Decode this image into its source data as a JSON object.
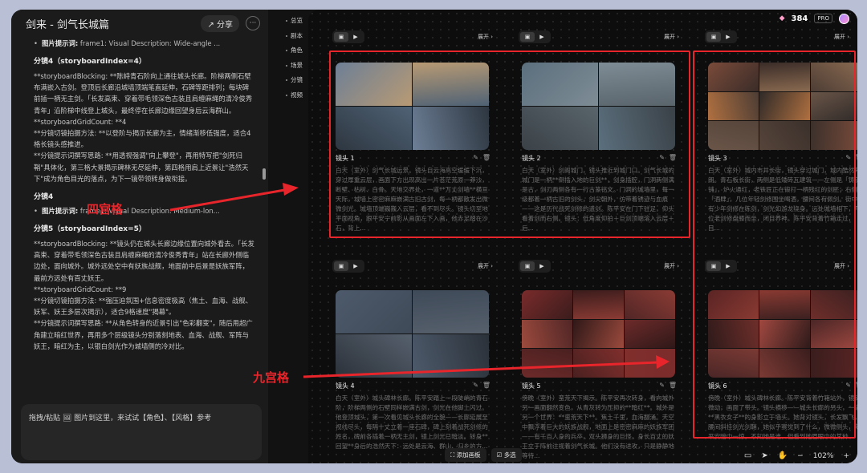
{
  "window": {
    "title": "剑来 - 剑气长城篇",
    "share_label": "分享",
    "more_label": "···"
  },
  "chat": {
    "blocks": [
      {
        "type": "bullet",
        "key": "图片提示词:",
        "text": "frame1: Visual Description: Wide-angle ..."
      },
      {
        "type": "heading",
        "text": "分镜4（storyboardIndex=4）"
      },
      {
        "type": "para",
        "text": "**storyboardBlocking: **陈峙青石阶向上通往城头长廊。阶梯两侧石壁布满嵌入古剑。登顶后长廊沿城墙顶端笔直延伸，石碑等距排列；每块碑前插一柄无主剑。「长发高束、穿着带毛领深色古装且肩缠麻绳的清冷俊秀青年」沿阶梯中线登上城头，最终停在长廊边缘回望身后云海群山。"
      },
      {
        "type": "para",
        "text": "**storyboardGridCount: **4"
      },
      {
        "type": "para",
        "text": "**分镜切镜拍摄方法: **以登阶与揭示长廊为主，情绪渐移低强度，适合4格长镜头感推进。"
      },
      {
        "type": "para",
        "text": "**分镜提示词撰写思路: **用透视强调\"向上攀登\"，再用特写把\"剑死归鞘\"具体化，第三格大景揭示碑林无尽延伸，第四格用肩上近景让\"浩然天下\"成为角色目光的落点，为下一镜带领转身做衔接。"
      },
      {
        "type": "heading",
        "text": "分镜4"
      },
      {
        "type": "bullet",
        "key": "图片提示词:",
        "text": "frame1: Visual Description: Medium-lon..."
      },
      {
        "type": "heading",
        "text": "分镜5（storyboardIndex=5）"
      },
      {
        "type": "para",
        "text": "**storyboardBlocking: **镜头仍在城头长廊边缘位置向城外看去。「长发高束、穿着带毛领深色古装且肩缠麻绳的清冷俊秀青年」站在长廊外侧临边处，面向城外。城外远处空中有妖族战舰，地面前中后景是妖族军阵，最前方远处有百丈妖王。"
      },
      {
        "type": "para",
        "text": "**storyboardGridCount: **9"
      },
      {
        "type": "para",
        "text": "**分镜切镜拍摄方法: **强压迫氛围+信息密度极高（焦土、血海、战舰、妖军、妖王多层次揭示），适合9格速度\"揭幕\"。"
      },
      {
        "type": "para",
        "text": "**分镜提示词撰写思路: **从角色转身的近景引出\"色彩翻变\"，随后用超广角建立暗红世界，再用多个层级镜头分别落刻地表、血海、战舰、军阵与妖王，暗红为主，以银白剑光作为城墙侧的冷对比。"
      }
    ],
    "input_placeholder": "拖拽/粘贴 🖼 图片到这里，来试试【角色】、【风格】参考"
  },
  "nav": [
    "总览",
    "剧本",
    "角色",
    "场景",
    "分镜",
    "视频"
  ],
  "topbar": {
    "credits": "384",
    "plan": "PRO"
  },
  "columns": {
    "expand_label": "展开 ›"
  },
  "cards": [
    {
      "label": "镜头 1",
      "grid": 4,
      "palette": [
        "#6d7f96",
        "#b89a74",
        "#4f6275",
        "#2d3640"
      ],
      "desc": "白天（室外）剑气长城远景。镜头自云海高空缓缓下沉，穿过厚重云层，画面下方出现高出一片苍茫荒原一莽沙，断壁、枯树、白骨。天地交界处，一道**万丈剑墙**横亘天际，城墙上密密麻麻嵌满古旧古剑，每一柄都散发出微微剑光。城墙顶端巍巍入云层，看不到尽头。镜头切至地平面视角，跟平安宁前影从画面左下入画，他赤足踏在沙石，背上..."
    },
    {
      "label": "镜头 2",
      "grid": 4,
      "palette": [
        "#5b6f7d",
        "#7e8c95",
        "#59646b",
        "#3a4147"
      ],
      "desc": "白天（室外）剑阁城门，镜头推近到城门口。剑气长城的城门是一柄**倒插入地的巨剑**，剑身插腔，门洞两侧满是古，剑刃两侧各有一行古篆铭文。门洞的城墙里，每一级都着一柄古旧的剑头，剑尖朝外，仿带着锈迹与血痕——这是历代战死剑修的遗剑。陈平安在门下驻足，仰头看着剑而右侧。镜头：低角度仰拍＋巨剑顶端溶入云层＋后..."
    },
    {
      "label": "镜头 3",
      "grid": 9,
      "palette": [
        "#7a4b3a",
        "#3a2c28",
        "#8a6a50",
        "#4d3d35",
        "#b07040",
        "#2f2a28",
        "#6a5548",
        "#55443a",
        "#3b302b"
      ],
      "desc": "白天（室外）城内市井长街，镜头穿过城门，城内酷然开朗。青石板长街，两侧是低矮砖瓦建筑——左侧是「铸剑铺」，炉火通红，老铁匠正在锻打一柄残红的剑胚；右侧是「酒肆」，几位年轻剑修围坐喝酒，腰间各有佩剑。街中央有少年剑修在练剑，剑光如游龙绕身。远处城墙相下，几位老剑修盘膝而坐，闭目养神。陈平安背着竹箱走过，目..."
    },
    {
      "label": "镜头 4",
      "grid": 4,
      "palette": [
        "#4d5a6b",
        "#3f4a58",
        "#56606d",
        "#2b3139"
      ],
      "desc": "白天（室外）城头碑林长廊。陈平安踏上一段陡峭的青石阶，阶梯两侧的石壁同样嵌满古剑，剑光在他脚上闪过。他登顶城头，第一次看见城头长廊的全貌——长廊延展至视线尽头，每隔十丈立着一座石碑，碑上刻着战死剑修的姓名，碑前各插着一柄无主剑，镜上剑光已暗淡。转身**回望**身后的浩然天下：远处是云海、群山、归乡的方..."
    },
    {
      "label": "镜头 5",
      "grid": 9,
      "palette": [
        "#7a2b2b",
        "#3b1c1c",
        "#8b3b34",
        "#512626",
        "#9c4a3d",
        "#2f1818",
        "#6d2a2a",
        "#4a2020",
        "#802f2c"
      ],
      "desc": "傍晚（室外）蛮荒天下揭示。陈平安再次转身，看向城外另一画面翻然变色，从青灰转为压抑的**暗红**。城外是另一个世界：**蛮荒天下**。焦土千里，血海翻涌。天空中飘浮着巨大的妖族战舰，地面上是密密麻麻的妖族军团——有千百人身的兵卒，双头狮身的巨怪，身长百丈的妖王立于阵前注视着剑气长城。他们没有进攻，只是静静地等待..."
    },
    {
      "label": "镜头 6",
      "grid": 9,
      "palette": [
        "#5a2424",
        "#8a3a32",
        "#3b2020",
        "#6e2e2a",
        "#2e1a1a",
        "#a04840",
        "#4a2626",
        "#7b3a34",
        "#3a1d1d"
      ],
      "desc": "傍晚（室外）城头碑林长廊。陈平安背着竹箱站外，镜头微动，画面了带头。镜头横移——城头长廊的另头，一道**黑衣女子**的身影立于墙头。她背对镜头，长发飘飞，腰间斜挂剑光剑鞘，她似乎察觉到了什么，微微侧头，陈平安暗中一惊，不知她是谁，但看到她眉眼中的某种..."
    }
  ],
  "annotations": {
    "four_grid": "四宫格",
    "nine_grid": "九宫格"
  },
  "bottom_bar": {
    "add_board": "添加画板",
    "multi_select": "多选",
    "zoom": "102%",
    "zoom_out": "−",
    "zoom_in": "+"
  }
}
